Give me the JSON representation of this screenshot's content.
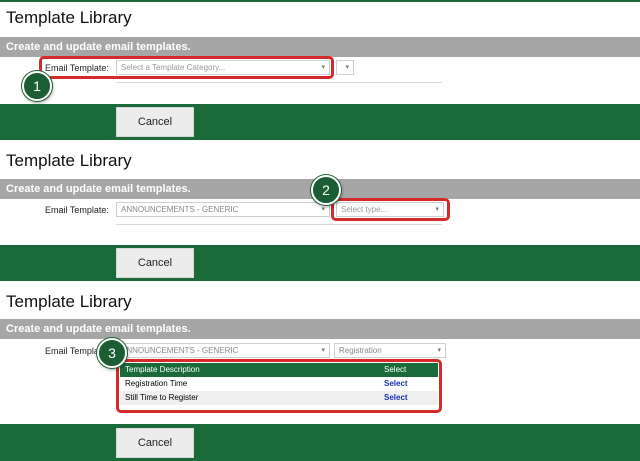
{
  "page": {
    "title": "Template Library",
    "subtitle": "Create and update email templates.",
    "cancel_label": "Cancel"
  },
  "step1": {
    "field_label": "Email Template:",
    "category_value": "Select a Template Category...",
    "type_value": "",
    "marker": "1"
  },
  "step2": {
    "field_label": "Email Template:",
    "category_value": "ANNOUNCEMENTS - GENERIC",
    "type_value": "Select type...",
    "marker": "2"
  },
  "step3": {
    "field_label": "Email Templat",
    "category_value": "ANNOUNCEMENTS - GENERIC",
    "type_value": "Registration",
    "marker": "3",
    "table": {
      "headers": [
        "Template Description",
        "Select"
      ],
      "rows": [
        {
          "description": "Registration Time",
          "action": "Select"
        },
        {
          "description": "Still Time to Register",
          "action": "Select"
        }
      ]
    }
  },
  "colors": {
    "brand_green": "#1b6b3a",
    "subbar_gray": "#a6a6a6",
    "highlight_red": "#d42a2a",
    "link_blue": "#1a2fb5"
  },
  "icons": {
    "dropdown": "chevron-down-icon"
  }
}
